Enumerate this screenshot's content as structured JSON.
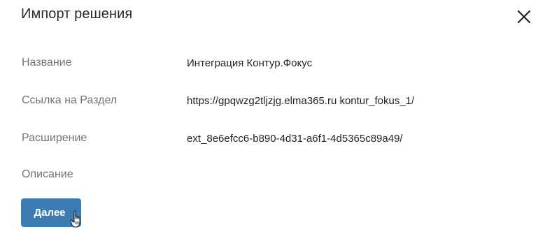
{
  "dialog": {
    "title": "Импорт решения",
    "close_icon": "close-icon"
  },
  "fields": [
    {
      "label": "Название",
      "value": "Интеграция Контур.Фокус"
    },
    {
      "label": "Ссылка на Раздел",
      "value": "https://gpqwzg2tljzjg.elma365.ru kontur_fokus_1/"
    },
    {
      "label": "Расширение",
      "value": "ext_8e6efcc6-b890-4d31-a6f1-4d5365c89a49/"
    },
    {
      "label": "Описание",
      "value": ""
    }
  ],
  "actions": {
    "next_label": "Далее"
  },
  "colors": {
    "accent": "#3d7cb2",
    "label": "#6f7478",
    "text": "#1f2326"
  }
}
